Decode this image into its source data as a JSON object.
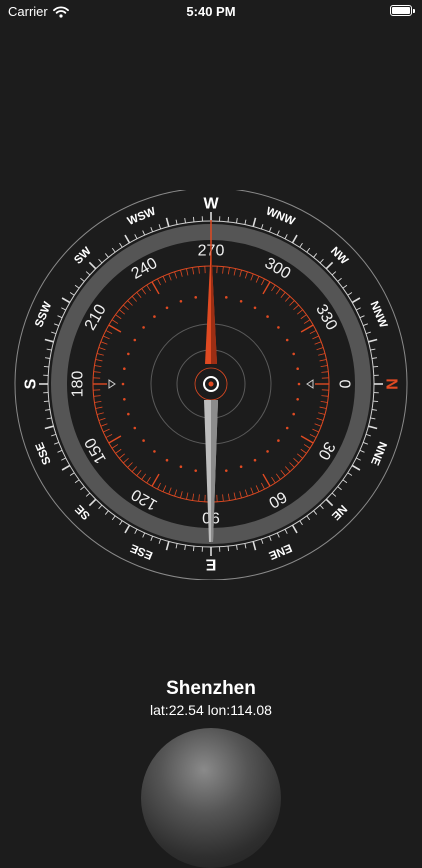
{
  "status_bar": {
    "carrier": "Carrier",
    "time": "5:40 PM"
  },
  "compass": {
    "heading_degrees": 270,
    "outer_labels": [
      {
        "text": "N",
        "angle": 0,
        "accent": true
      },
      {
        "text": "NNE",
        "angle": 22.5
      },
      {
        "text": "NE",
        "angle": 45
      },
      {
        "text": "ENE",
        "angle": 67.5
      },
      {
        "text": "E",
        "angle": 90
      },
      {
        "text": "ESE",
        "angle": 112.5
      },
      {
        "text": "SE",
        "angle": 135
      },
      {
        "text": "SSE",
        "angle": 157.5
      },
      {
        "text": "S",
        "angle": 180
      },
      {
        "text": "SSW",
        "angle": 202.5
      },
      {
        "text": "SW",
        "angle": 225
      },
      {
        "text": "WSW",
        "angle": 247.5
      },
      {
        "text": "W",
        "angle": 270
      },
      {
        "text": "WNW",
        "angle": 292.5
      },
      {
        "text": "NW",
        "angle": 315
      },
      {
        "text": "NNW",
        "angle": 337.5
      }
    ],
    "degree_labels": [
      "0",
      "30",
      "60",
      "90",
      "120",
      "150",
      "180",
      "210",
      "240",
      "270",
      "300",
      "330"
    ]
  },
  "location": {
    "city": "Shenzhen",
    "coordinates": "lat:22.54  lon:114.08"
  },
  "colors": {
    "accent": "#e04a22",
    "background": "#1c1c1c",
    "dial_ring": "#555555"
  }
}
